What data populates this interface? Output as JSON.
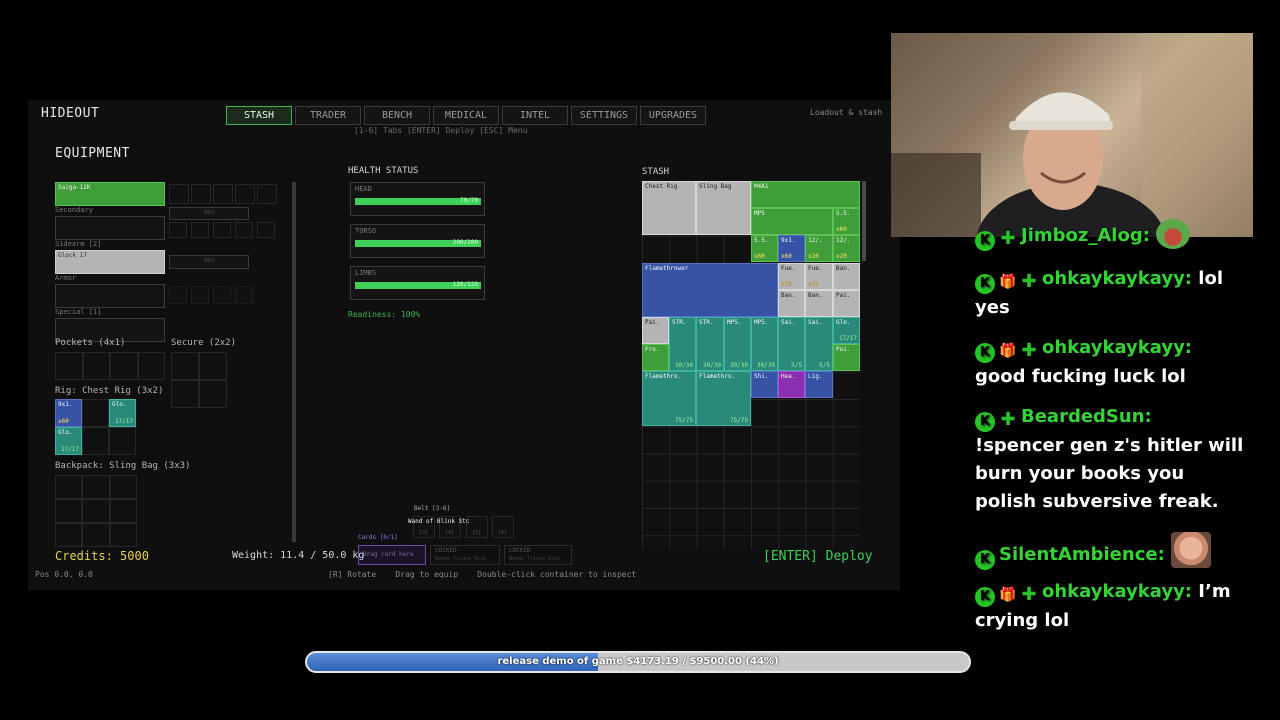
{
  "game": {
    "header_title": "HIDEOUT",
    "tabs": [
      {
        "label": "STASH",
        "active": true
      },
      {
        "label": "TRADER",
        "active": false
      },
      {
        "label": "BENCH",
        "active": false
      },
      {
        "label": "MEDICAL",
        "active": false
      },
      {
        "label": "INTEL",
        "active": false
      },
      {
        "label": "SETTINGS",
        "active": false
      },
      {
        "label": "UPGRADES",
        "active": false
      }
    ],
    "subtitle_right": "Loadout & stash",
    "key_hint": "[1-6] Tabs  [ENTER] Deploy  [ESC] Menu",
    "equipment": {
      "title": "EQUIPMENT",
      "primary_item": "Saiga-12K",
      "secondary_label": "Secondary",
      "sidearm_label": "Sidearm [2]",
      "sidearm_item": "Glock 17",
      "armor_label": "Armor",
      "special_label": "Special [1]",
      "mag_label_1": "MAG",
      "mag_label_2": "MAG",
      "pockets_label": "Pockets (4x1)",
      "secure_label": "Secure (2x2)",
      "rig_label": "Rig: Chest Rig (3x2)",
      "rig_items": [
        {
          "name": "9x1.",
          "qty": "x60"
        },
        {
          "name": "Glo.",
          "count": "17/17"
        },
        {
          "name": "Glo.",
          "count": "17/17"
        }
      ],
      "backpack_label": "Backpack: Sling Bag (3x3)"
    },
    "health": {
      "title": "HEALTH STATUS",
      "parts": [
        {
          "name": "HEAD",
          "value": "70/70",
          "pct": 1.0
        },
        {
          "name": "TORSO",
          "value": "200/200",
          "pct": 1.0
        },
        {
          "name": "LIMBS",
          "value": "120/120",
          "pct": 1.0
        }
      ],
      "readiness": "Readiness: 100%"
    },
    "belt": {
      "label": "Belt [3-6]",
      "item": "Wand of Blink Stc",
      "slot_keys": [
        "[3]",
        "[4]",
        "[5]",
        "[6]"
      ]
    },
    "cards": {
      "label": "Cards [0/1]",
      "drop_hint": "Drag card here",
      "locked_1": "LOCKED",
      "locked_1_sub": "Needs Triune Deck",
      "locked_2": "LOCKED",
      "locked_2_sub": "Needs Triune Deck"
    },
    "stash": {
      "title": "STASH",
      "items": [
        {
          "name": "Chest Rig"
        },
        {
          "name": "Sling Bag"
        },
        {
          "name": "M4A1"
        },
        {
          "name": "MP5"
        },
        {
          "name": "5.5.",
          "qty": "x60"
        },
        {
          "name": "5.5.",
          "qty": "x60"
        },
        {
          "name": "9x1.",
          "qty": "x60"
        },
        {
          "name": "12/.",
          "qty": "x20"
        },
        {
          "name": "12/.",
          "qty": "x20"
        },
        {
          "name": "Flamethrower"
        },
        {
          "name": "Fue.",
          "qty": "x75"
        },
        {
          "name": "Fue.",
          "qty": "x75"
        },
        {
          "name": "Ban."
        },
        {
          "name": "Ban."
        },
        {
          "name": "Ban."
        },
        {
          "name": "Pai."
        },
        {
          "name": "Pai."
        },
        {
          "name": "STR.",
          "count": "30/30"
        },
        {
          "name": "STR.",
          "count": "30/30"
        },
        {
          "name": "MP5.",
          "count": "30/30"
        },
        {
          "name": "MP5.",
          "count": "30/30"
        },
        {
          "name": "Sai.",
          "count": "5/5"
        },
        {
          "name": "Sai.",
          "count": "5/5"
        },
        {
          "name": "Glo.",
          "count": "17/17"
        },
        {
          "name": "Fro."
        },
        {
          "name": "Poi."
        },
        {
          "name": "Flamethro.",
          "count": "75/75"
        },
        {
          "name": "Flamethro.",
          "count": "75/75"
        },
        {
          "name": "Shi."
        },
        {
          "name": "Hea."
        },
        {
          "name": "Lig."
        }
      ]
    },
    "credits": "Credits: 5000",
    "weight": "Weight: 11.4 / 50.0 kg",
    "deploy": "[ENTER] Deploy",
    "pos": "Pos 0.0, 0.0",
    "controls_hint": "[R] Rotate    Drag to equip    Double-click container to inspect"
  },
  "chat": [
    {
      "user": "Jimboz_Alog:",
      "message": "",
      "gift": false,
      "emote": "pepe-emote"
    },
    {
      "user": "ohkaykaykayy:",
      "message": "lol yes",
      "gift": true
    },
    {
      "user": "ohkaykaykayy:",
      "message": "good fucking luck lol",
      "gift": true
    },
    {
      "user": "BeardedSun:",
      "message": "!spencer gen z's hitler will burn your books you polish subversive freak.",
      "gift": false
    },
    {
      "user": "SilentAmbience:",
      "message": "",
      "gift": false,
      "emote": "face-emote"
    },
    {
      "user": "ohkaykaykayy:",
      "message": "I’m crying lol",
      "gift": true
    }
  ],
  "goal": {
    "text": "release demo of game $4173.19 / $9500.00 (44%)",
    "progress": 0.44
  },
  "colors": {
    "accent_green": "#3fb34f",
    "chat_green": "#35d435",
    "progress_blue": "#2f63b6"
  }
}
